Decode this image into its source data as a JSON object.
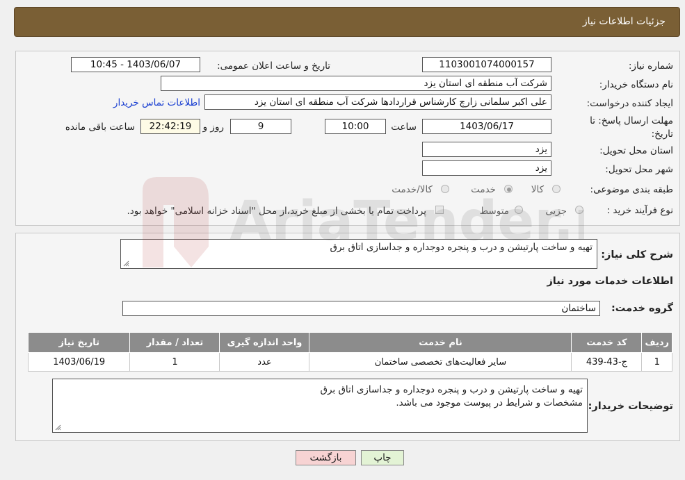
{
  "header": {
    "title": "جزئیات اطلاعات نیاز"
  },
  "form": {
    "need_number_label": "شماره نیاز:",
    "need_number": "1103001074000157",
    "announce_label": "تاریخ و ساعت اعلان عمومی:",
    "announce_value": "1403/06/07 - 10:45",
    "buyer_org_label": "نام دستگاه خریدار:",
    "buyer_org": "شرکت آب منطقه ای استان یزد",
    "creator_label": "ایجاد کننده درخواست:",
    "creator": "علی اکبر سلمانی زارچ کارشناس قراردادها شرکت آب منطقه ای استان یزد",
    "contact_link": "اطلاعات تماس خریدار",
    "deadline_label_line1": "مهلت ارسال پاسخ: تا",
    "deadline_label_line2": "تاریخ:",
    "deadline_date": "1403/06/17",
    "time_label": "ساعت",
    "deadline_time": "10:00",
    "days_value": "9",
    "days_label": "روز و",
    "remaining_time": "22:42:19",
    "remaining_label": "ساعت باقی مانده",
    "province_label": "استان محل تحویل:",
    "province": "یزد",
    "city_label": "شهر محل تحویل:",
    "city": "یزد",
    "category_label": "طبقه بندی موضوعی:",
    "category_options": [
      "کالا",
      "خدمت",
      "کالا/خدمت"
    ],
    "category_selected": "خدمت",
    "process_label": "نوع فرآیند خرید :",
    "process_options": [
      "جزیی",
      "متوسط"
    ],
    "payment_note": "پرداخت تمام یا بخشی از مبلغ خرید،از محل \"اسناد خزانه اسلامی\" خواهد بود."
  },
  "summary": {
    "label": "شرح کلی نیاز:",
    "text": "تهیه و ساخت پارتیشن و درب و پنجره دوجداره و جداسازی اتاق برق"
  },
  "services": {
    "section_title": "اطلاعات خدمات مورد نیاز",
    "group_label": "گروه خدمت:",
    "group_value": "ساختمان",
    "columns": [
      "ردیف",
      "کد خدمت",
      "نام خدمت",
      "واحد اندازه گیری",
      "تعداد / مقدار",
      "تاریخ نیاز"
    ],
    "rows": [
      [
        "1",
        "ج-43-439",
        "سایر فعالیت‌های تخصصی ساختمان",
        "عدد",
        "1",
        "1403/06/19"
      ]
    ]
  },
  "buyer_notes": {
    "label": "توضیحات خریدار:",
    "lines": [
      "تهیه و ساخت پارتیشن و درب و پنجره دوجداره و جداسازی اتاق برق",
      "مشخصات و شرایط در پیوست موجود می باشد."
    ]
  },
  "buttons": {
    "print": "چاپ",
    "back": "بازگشت"
  },
  "watermark": {
    "text": "AriaTender.neT"
  },
  "colors": {
    "header_bg": "#7a5f35",
    "table_header_bg": "#8c8c8c",
    "link": "#1a3fd1"
  }
}
